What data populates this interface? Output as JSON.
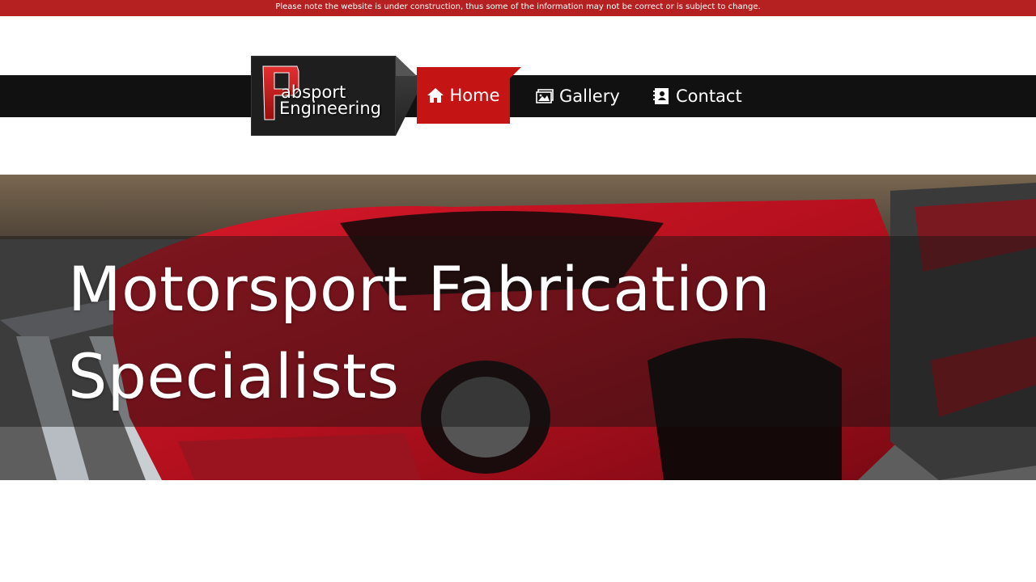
{
  "notice": {
    "text": "Please note the website is under construction, thus some of the information may not be correct or is subject to change."
  },
  "logo": {
    "line1": "absport",
    "line2": "Engineering"
  },
  "nav": {
    "items": [
      {
        "label": "Home",
        "icon": "home-icon",
        "active": true
      },
      {
        "label": "Gallery",
        "icon": "picture-icon",
        "active": false
      },
      {
        "label": "Contact",
        "icon": "contact-card-icon",
        "active": false
      }
    ]
  },
  "hero": {
    "title_line1": "Motorsport Fabrication",
    "title_line2": "Specialists"
  },
  "colors": {
    "accent": "#c41414",
    "notice_bar": "#b52020",
    "navbar": "#111111"
  }
}
